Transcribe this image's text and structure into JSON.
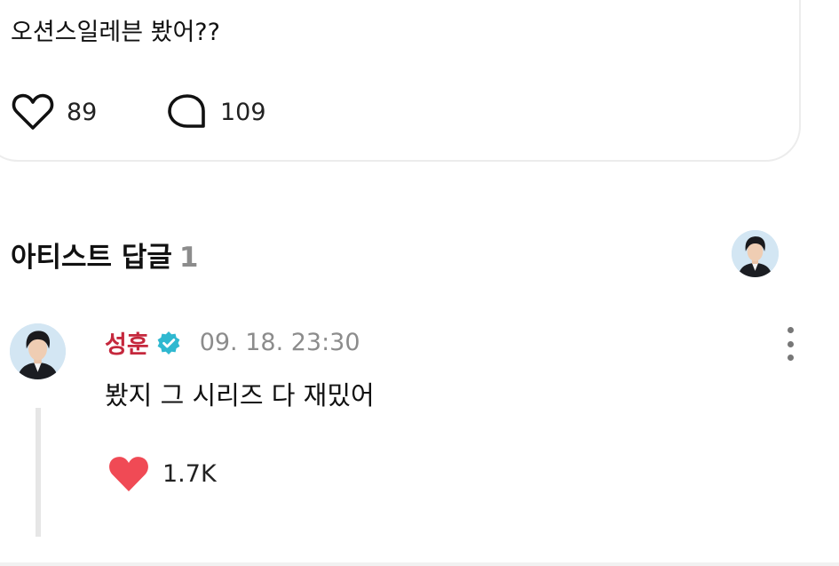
{
  "post": {
    "text": "오션스일레븐 봤어??",
    "like_count": "89",
    "comment_count": "109"
  },
  "artist_replies": {
    "title": "아티스트 답글",
    "count": "1"
  },
  "reply": {
    "author": "성훈",
    "timestamp": "09. 18. 23:30",
    "text": "봤지 그 시리즈 다 재밌어",
    "like_count": "1.7K"
  },
  "colors": {
    "author": "#c5283d",
    "liked_heart": "#f04a55",
    "verified_badge": "#2fb8d0",
    "muted_text": "#8c8c8c"
  },
  "icons": {
    "like": "heart-outline-icon",
    "comment": "speech-bubble-icon",
    "verified": "verified-badge-icon",
    "reply_like": "heart-filled-icon",
    "more": "more-vertical-icon"
  }
}
